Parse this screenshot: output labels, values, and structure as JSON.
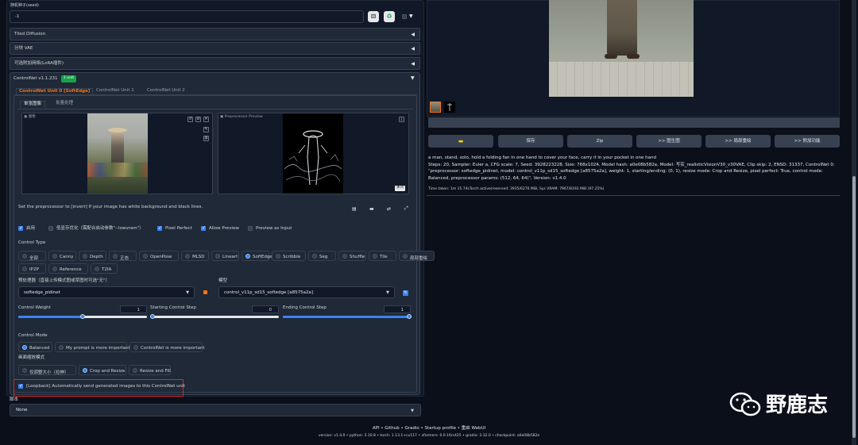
{
  "seed": {
    "label": "随机种子(seed)",
    "value": "-1"
  },
  "accordions": [
    {
      "label": "Tiled Diffusion"
    },
    {
      "label": "分块 VAE"
    },
    {
      "label": "可选附加网络(LoRA插件)"
    }
  ],
  "controlnet": {
    "title": "ControlNet v1.1.231",
    "badge": "1 unit",
    "tabs": [
      "ControlNet Unit 0 [SoftEdge]",
      "ControlNet Unit 1",
      "ControlNet Unit 2"
    ],
    "subtabs": [
      "单张图像",
      "批量处理"
    ],
    "image_label": "图像",
    "preview_label": "Preprocessor Preview",
    "close_label": "关闭",
    "hint": "Set the preprocessor to [invert] If your image has white background and black lines.",
    "options": {
      "enable": "启用",
      "lowvram": "低显存优化（需配合启动参数\"--lowvram\"）",
      "pixel_perfect": "Pixel Perfect",
      "allow_preview": "Allow Preview",
      "preview_input": "Preview as Input"
    },
    "control_type_label": "Control Type",
    "control_types": [
      "全部",
      "Canny",
      "Depth",
      "正态",
      "OpenPose",
      "MLSD",
      "Lineart",
      "SoftEdge",
      "Scribble",
      "Seg",
      "Shuffle",
      "Tile",
      "局部重绘",
      "IP2P",
      "Reference",
      "T2IA"
    ],
    "control_type_selected": "SoftEdge",
    "preprocessor_label": "预处理器（直接上传模式图或草图时可选\"无\"）",
    "preprocessor_value": "softedge_pidinet",
    "model_label": "模型",
    "model_value": "control_v11p_sd15_softedge [a8575a2a]",
    "weight": {
      "label": "Control Weight",
      "value": "1",
      "fraction": 0.5
    },
    "start": {
      "label": "Starting Control Step",
      "value": "0",
      "fraction": 0.0
    },
    "end": {
      "label": "Ending Control Step",
      "value": "1",
      "fraction": 1.0
    },
    "mode_label": "Control Mode",
    "modes": [
      "Balanced",
      "My prompt is more important",
      "ControlNet is more important"
    ],
    "mode_selected": "Balanced",
    "resize_label": "画面缩放模式",
    "resize_modes": [
      "仅调整大小（拉伸）",
      "Crop and Resize",
      "Resize and Fill"
    ],
    "resize_selected": "Crop and Resize",
    "loopback": "[Loopback] Automatically send generated images to this ControlNet unit"
  },
  "script": {
    "label": "脚本",
    "value": "None"
  },
  "output": {
    "buttons": [
      "保存",
      "Zip",
      ">> 图生图",
      ">> 局部重绘",
      ">> 附加功能"
    ],
    "prompt": "a man, stand, solo, hold a folding fan in one hand to cover your face, carry it in your pocket in one hand",
    "params": "Steps: 20, Sampler: Euler a, CFG scale: 7, Seed: 3928223228, Size: 768x1024, Model hash: a0e08b582e, Model: 写实_realisticVisionV30_v30VAE, Clip skip: 2, ENSD: 31337, ControlNet 0: \"preprocessor: softedge_pidinet, model: control_v11p_sd15_softedge [a8575a2a], weight: 1, starting/ending: (0, 1), resize mode: Crop and Resize, pixel perfect: True, control mode: Balanced, preprocessor params: (512, 64, 64)\", Version: v1.4.0",
    "time": "Time taken: 1m 15.74sTorch active/reserved: 3935/6276 MiB, Sys VRAM: 7967/8192 MiB (97.25%)"
  },
  "footer": {
    "links": "API  •  Github  •  Gradio  •  Startup profile  •  重启 WebUI",
    "versions": "version: v1.4.0  •  python: 3.10.8  •  torch: 1.13.1+cu117  •  xformers: 0.0.16rc425  •  gradio: 3.32.0  •  checkpoint: a0e08b582e"
  },
  "watermark": "野鹿志",
  "colors": {
    "accent": "#3b82f6",
    "badge": "#16a34a",
    "highlight": "#dc2626",
    "tab_active": "#f97316"
  }
}
